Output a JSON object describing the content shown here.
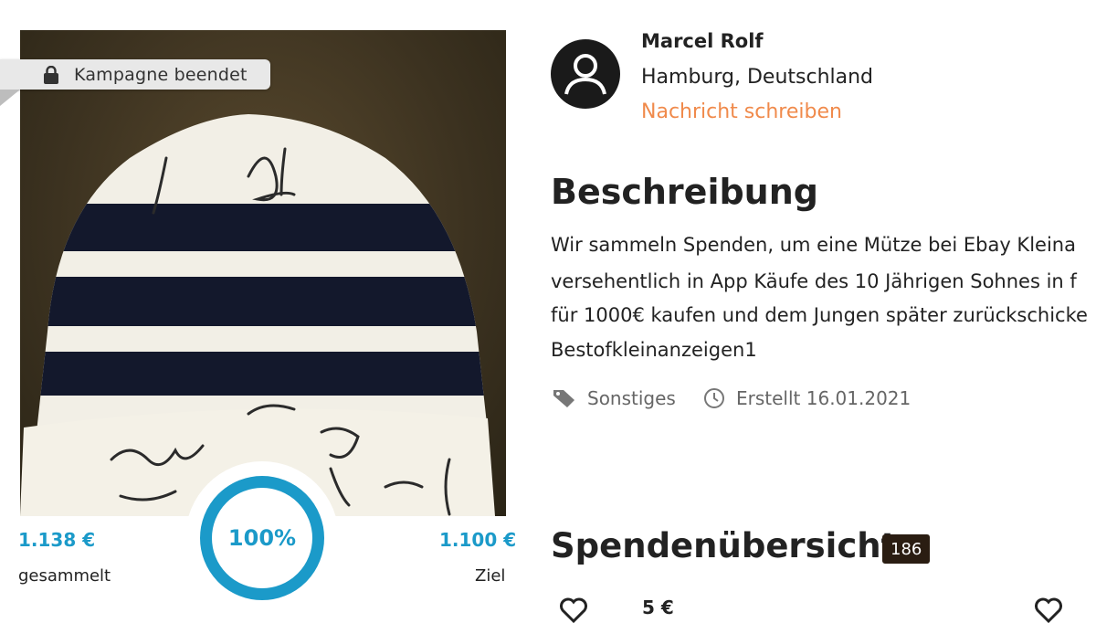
{
  "campaign": {
    "status_badge": "Kampagne beendet",
    "raised_amount": "1.138 €",
    "raised_label": "gesammelt",
    "progress_text": "100%",
    "progress_fraction": 1.0,
    "goal_amount": "1.100 €",
    "goal_label": "Ziel"
  },
  "organizer": {
    "name": "Marcel Rolf",
    "location": "Hamburg, Deutschland",
    "message_link": "Nachricht schreiben"
  },
  "description": {
    "title": "Beschreibung",
    "lines": [
      "Wir sammeln Spenden, um eine Mütze bei Ebay Kleina",
      "versehentlich in App Käufe des 10 Jährigen Sohnes in f",
      "für 1000€ kaufen und dem Jungen später zurückschicke",
      "Bestofkleinanzeigen1"
    ],
    "category": "Sonstiges",
    "created": "Erstellt 16.01.2021"
  },
  "donations": {
    "title": "Spendenübersicht",
    "count": "186",
    "first_amount": "5 €"
  },
  "colors": {
    "accent_blue": "#1b9ac9",
    "link_orange": "#f08a4b",
    "count_badge_bg": "#2a1d12"
  },
  "icons": [
    "lock-icon",
    "user-avatar-icon",
    "tag-icon",
    "clock-icon",
    "heart-icon"
  ]
}
